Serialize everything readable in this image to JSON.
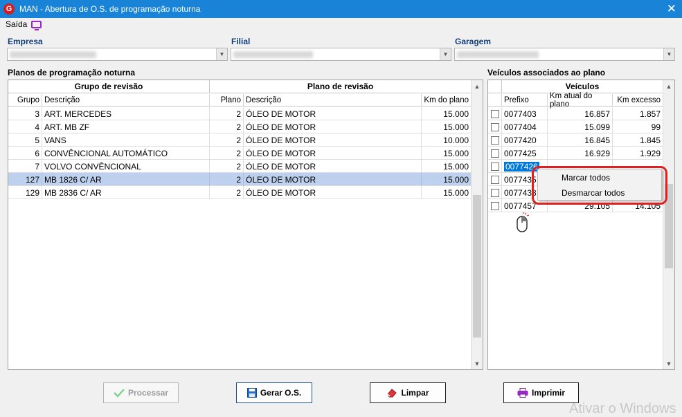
{
  "window": {
    "title": "MAN - Abertura de O.S. de programação noturna",
    "app_icon_letter": "G"
  },
  "menu": {
    "saida_label": "Saída"
  },
  "filters": {
    "empresa_label": "Empresa",
    "filial_label": "Filial",
    "garagem_label": "Garagem"
  },
  "plans": {
    "section_title": "Planos de programação noturna",
    "group_revisao_header": "Grupo de revisão",
    "plano_revisao_header": "Plano de revisão",
    "columns": [
      "Grupo",
      "Descrição",
      "Plano",
      "Descrição",
      "Km do plano"
    ],
    "rows": [
      {
        "grupo": "3",
        "descricao": "ART. MERCEDES",
        "plano": "2",
        "plano_descricao": "ÓLEO DE MOTOR",
        "km": "15.000"
      },
      {
        "grupo": "4",
        "descricao": "ART. MB ZF",
        "plano": "2",
        "plano_descricao": "ÓLEO DE MOTOR",
        "km": "15.000"
      },
      {
        "grupo": "5",
        "descricao": "VANS",
        "plano": "2",
        "plano_descricao": "ÓLEO DE MOTOR",
        "km": "10.000"
      },
      {
        "grupo": "6",
        "descricao": "CONVÊNCIONAL AUTOMÁTICO",
        "plano": "2",
        "plano_descricao": "ÓLEO DE MOTOR",
        "km": "15.000"
      },
      {
        "grupo": "7",
        "descricao": "VOLVO CONVÊNCIONAL",
        "plano": "2",
        "plano_descricao": "ÓLEO DE MOTOR",
        "km": "15.000"
      },
      {
        "grupo": "127",
        "descricao": "MB 1826 C/ AR",
        "plano": "2",
        "plano_descricao": "ÓLEO DE MOTOR",
        "km": "15.000"
      },
      {
        "grupo": "129",
        "descricao": "MB 2836 C/ AR",
        "plano": "2",
        "plano_descricao": "ÓLEO DE MOTOR",
        "km": "15.000"
      }
    ],
    "selected_row_index": 5
  },
  "vehicles": {
    "section_title": "Veículos associados ao plano",
    "group_header": "Veículos",
    "columns": [
      "Prefixo",
      "Km atual do plano",
      "Km excesso"
    ],
    "rows": [
      {
        "prefixo": "0077403",
        "km_atual": "16.857",
        "km_excesso": "1.857"
      },
      {
        "prefixo": "0077404",
        "km_atual": "15.099",
        "km_excesso": "99"
      },
      {
        "prefixo": "0077420",
        "km_atual": "16.845",
        "km_excesso": "1.845"
      },
      {
        "prefixo": "0077425",
        "km_atual": "16.929",
        "km_excesso": "1.929"
      },
      {
        "prefixo": "0077426",
        "km_atual": "",
        "km_excesso": ""
      },
      {
        "prefixo": "0077435",
        "km_atual": "",
        "km_excesso": ""
      },
      {
        "prefixo": "0077438",
        "km_atual": "",
        "km_excesso": ""
      },
      {
        "prefixo": "0077457",
        "km_atual": "29.105",
        "km_excesso": "14.105"
      }
    ],
    "selected_row_index": 4
  },
  "context_menu": {
    "marcar_todos": "Marcar todos",
    "desmarcar_todos": "Desmarcar todos"
  },
  "buttons": {
    "processar": "Processar",
    "gerar_os": "Gerar O.S.",
    "limpar": "Limpar",
    "imprimir": "Imprimir"
  },
  "watermark": "Ativar o Windows",
  "colors": {
    "titlebar": "#1883d7",
    "selection": "#bdd0ee",
    "highlight_red": "#e02020",
    "label_blue": "#123d7a"
  }
}
